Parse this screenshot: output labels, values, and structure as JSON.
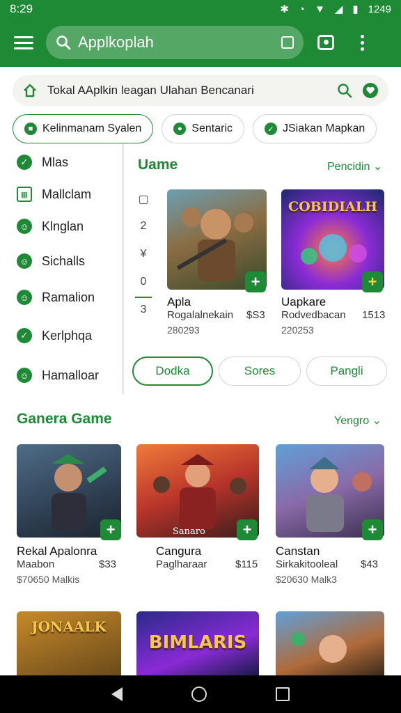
{
  "status_bar": {
    "time": "8:29",
    "clock": "1249"
  },
  "app_bar": {
    "search_text": "Applkoplah"
  },
  "tip_bar": {
    "text": "Tokal AAplkin leagan Ulahan Bencanari"
  },
  "chips": [
    {
      "label": "Kelinmanam Syalen",
      "active": true
    },
    {
      "label": "Sentaric",
      "active": false
    },
    {
      "label": "JSiakan Mapkan",
      "active": false
    }
  ],
  "sidebar": {
    "items": [
      {
        "label": "Mlas",
        "icon": "check-icon"
      },
      {
        "label": "Mallclam",
        "icon": "grid-icon"
      },
      {
        "label": "Klnglan",
        "icon": "smile-icon"
      },
      {
        "label": "Sichalls",
        "icon": "smile-icon"
      },
      {
        "label": "Ramalion",
        "icon": "smile-icon"
      },
      {
        "label": "Kerlphqa",
        "icon": "check-icon"
      },
      {
        "label": "Hamalloar",
        "icon": "smile-icon"
      }
    ]
  },
  "section_top": {
    "title": "Uame",
    "link": "Pencidin",
    "mini_index": [
      "▢",
      "2",
      "¥",
      "0",
      "3"
    ],
    "cards": [
      {
        "title": "Apla",
        "sub": "Rogalalnekain",
        "price": "$S3",
        "meta": "280293",
        "thumb_text": ""
      },
      {
        "title": "Uapkare",
        "sub": "Rodvedbacan",
        "price": "1513",
        "meta": "220253",
        "thumb_text": "COBIDIALH"
      }
    ],
    "pills": [
      {
        "label": "Dodka",
        "active": true
      },
      {
        "label": "Sores",
        "active": false
      },
      {
        "label": "Pangli",
        "active": false
      }
    ]
  },
  "section_games": {
    "title": "Ganera Game",
    "link": "Yengro",
    "cards": [
      {
        "title": "Rekal Apalonra",
        "sub": "Maabon",
        "price": "$33",
        "meta": "$70650 Malkis",
        "thumb_text": ""
      },
      {
        "title": "Cangura",
        "sub": "Paglharaar",
        "price": "$115",
        "meta": "",
        "thumb_text": "Sanaro"
      },
      {
        "title": "Canstan",
        "sub": "Sirkakitooleal",
        "price": "$43",
        "meta": "$20630 Malk3",
        "thumb_text": ""
      }
    ],
    "bottom_thumbs": [
      "JONAALK",
      "BIMLARIS",
      ""
    ]
  }
}
